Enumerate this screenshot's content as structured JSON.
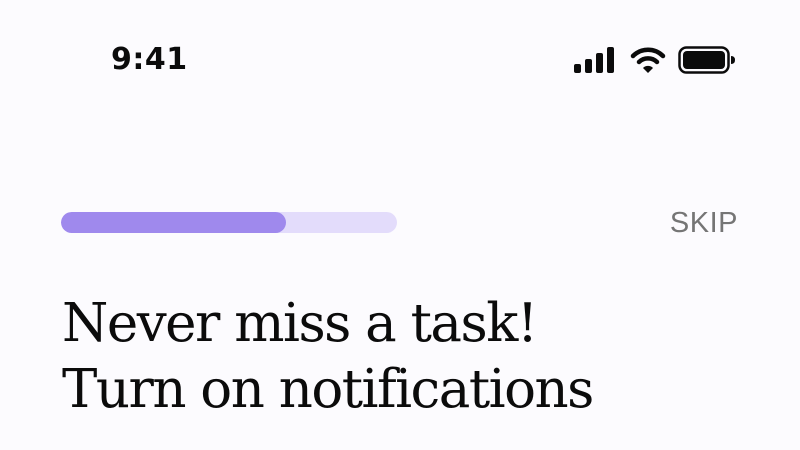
{
  "status_bar": {
    "time": "9:41",
    "icons": [
      "signal-icon",
      "wifi-icon",
      "battery-icon"
    ]
  },
  "onboarding": {
    "progress": 0.67,
    "skip_label": "SKIP",
    "headline_line1": "Never miss a task!",
    "headline_line2": "Turn on notifications"
  },
  "colors": {
    "background": "#fcfbfe",
    "progress_fill": "#9f89ed",
    "progress_track": "#e3dcfb",
    "text_primary": "#0b0b0b",
    "text_secondary": "#757575"
  }
}
